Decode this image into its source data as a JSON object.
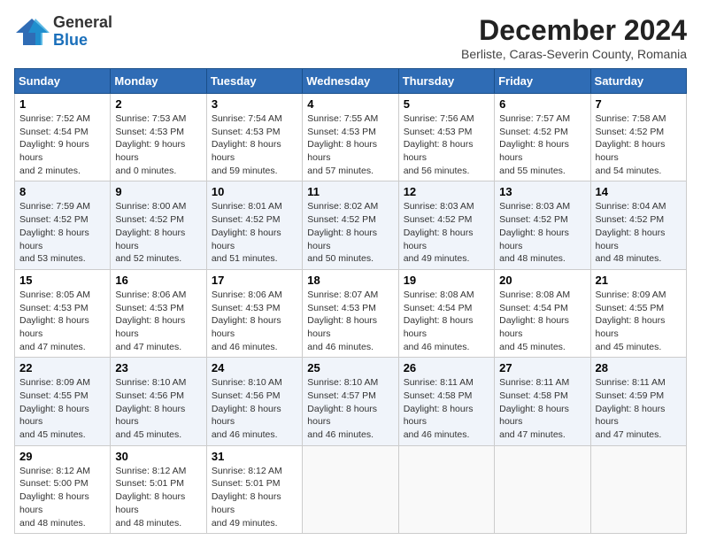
{
  "header": {
    "logo_line1": "General",
    "logo_line2": "Blue",
    "month_title": "December 2024",
    "subtitle": "Berliste, Caras-Severin County, Romania"
  },
  "weekdays": [
    "Sunday",
    "Monday",
    "Tuesday",
    "Wednesday",
    "Thursday",
    "Friday",
    "Saturday"
  ],
  "weeks": [
    [
      {
        "day": "1",
        "sunrise": "7:52 AM",
        "sunset": "4:54 PM",
        "daylight": "9 hours and 2 minutes."
      },
      {
        "day": "2",
        "sunrise": "7:53 AM",
        "sunset": "4:53 PM",
        "daylight": "9 hours and 0 minutes."
      },
      {
        "day": "3",
        "sunrise": "7:54 AM",
        "sunset": "4:53 PM",
        "daylight": "8 hours and 59 minutes."
      },
      {
        "day": "4",
        "sunrise": "7:55 AM",
        "sunset": "4:53 PM",
        "daylight": "8 hours and 57 minutes."
      },
      {
        "day": "5",
        "sunrise": "7:56 AM",
        "sunset": "4:53 PM",
        "daylight": "8 hours and 56 minutes."
      },
      {
        "day": "6",
        "sunrise": "7:57 AM",
        "sunset": "4:52 PM",
        "daylight": "8 hours and 55 minutes."
      },
      {
        "day": "7",
        "sunrise": "7:58 AM",
        "sunset": "4:52 PM",
        "daylight": "8 hours and 54 minutes."
      }
    ],
    [
      {
        "day": "8",
        "sunrise": "7:59 AM",
        "sunset": "4:52 PM",
        "daylight": "8 hours and 53 minutes."
      },
      {
        "day": "9",
        "sunrise": "8:00 AM",
        "sunset": "4:52 PM",
        "daylight": "8 hours and 52 minutes."
      },
      {
        "day": "10",
        "sunrise": "8:01 AM",
        "sunset": "4:52 PM",
        "daylight": "8 hours and 51 minutes."
      },
      {
        "day": "11",
        "sunrise": "8:02 AM",
        "sunset": "4:52 PM",
        "daylight": "8 hours and 50 minutes."
      },
      {
        "day": "12",
        "sunrise": "8:03 AM",
        "sunset": "4:52 PM",
        "daylight": "8 hours and 49 minutes."
      },
      {
        "day": "13",
        "sunrise": "8:03 AM",
        "sunset": "4:52 PM",
        "daylight": "8 hours and 48 minutes."
      },
      {
        "day": "14",
        "sunrise": "8:04 AM",
        "sunset": "4:52 PM",
        "daylight": "8 hours and 48 minutes."
      }
    ],
    [
      {
        "day": "15",
        "sunrise": "8:05 AM",
        "sunset": "4:53 PM",
        "daylight": "8 hours and 47 minutes."
      },
      {
        "day": "16",
        "sunrise": "8:06 AM",
        "sunset": "4:53 PM",
        "daylight": "8 hours and 47 minutes."
      },
      {
        "day": "17",
        "sunrise": "8:06 AM",
        "sunset": "4:53 PM",
        "daylight": "8 hours and 46 minutes."
      },
      {
        "day": "18",
        "sunrise": "8:07 AM",
        "sunset": "4:53 PM",
        "daylight": "8 hours and 46 minutes."
      },
      {
        "day": "19",
        "sunrise": "8:08 AM",
        "sunset": "4:54 PM",
        "daylight": "8 hours and 46 minutes."
      },
      {
        "day": "20",
        "sunrise": "8:08 AM",
        "sunset": "4:54 PM",
        "daylight": "8 hours and 45 minutes."
      },
      {
        "day": "21",
        "sunrise": "8:09 AM",
        "sunset": "4:55 PM",
        "daylight": "8 hours and 45 minutes."
      }
    ],
    [
      {
        "day": "22",
        "sunrise": "8:09 AM",
        "sunset": "4:55 PM",
        "daylight": "8 hours and 45 minutes."
      },
      {
        "day": "23",
        "sunrise": "8:10 AM",
        "sunset": "4:56 PM",
        "daylight": "8 hours and 45 minutes."
      },
      {
        "day": "24",
        "sunrise": "8:10 AM",
        "sunset": "4:56 PM",
        "daylight": "8 hours and 46 minutes."
      },
      {
        "day": "25",
        "sunrise": "8:10 AM",
        "sunset": "4:57 PM",
        "daylight": "8 hours and 46 minutes."
      },
      {
        "day": "26",
        "sunrise": "8:11 AM",
        "sunset": "4:58 PM",
        "daylight": "8 hours and 46 minutes."
      },
      {
        "day": "27",
        "sunrise": "8:11 AM",
        "sunset": "4:58 PM",
        "daylight": "8 hours and 47 minutes."
      },
      {
        "day": "28",
        "sunrise": "8:11 AM",
        "sunset": "4:59 PM",
        "daylight": "8 hours and 47 minutes."
      }
    ],
    [
      {
        "day": "29",
        "sunrise": "8:12 AM",
        "sunset": "5:00 PM",
        "daylight": "8 hours and 48 minutes."
      },
      {
        "day": "30",
        "sunrise": "8:12 AM",
        "sunset": "5:01 PM",
        "daylight": "8 hours and 48 minutes."
      },
      {
        "day": "31",
        "sunrise": "8:12 AM",
        "sunset": "5:01 PM",
        "daylight": "8 hours and 49 minutes."
      },
      null,
      null,
      null,
      null
    ]
  ]
}
